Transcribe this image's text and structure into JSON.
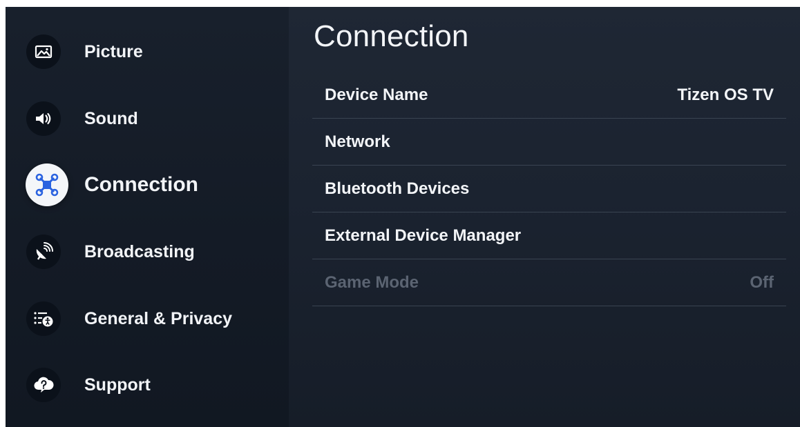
{
  "sidebar": {
    "items": [
      {
        "label": "Picture",
        "icon": "picture-icon"
      },
      {
        "label": "Sound",
        "icon": "speaker-icon"
      },
      {
        "label": "Connection",
        "icon": "connection-icon",
        "active": true
      },
      {
        "label": "Broadcasting",
        "icon": "satellite-dish-icon"
      },
      {
        "label": "General & Privacy",
        "icon": "general-privacy-icon"
      },
      {
        "label": "Support",
        "icon": "help-cloud-icon"
      }
    ]
  },
  "main": {
    "title": "Connection",
    "rows": [
      {
        "label": "Device Name",
        "value": "Tizen OS TV",
        "enabled": true
      },
      {
        "label": "Network",
        "value": "",
        "enabled": true
      },
      {
        "label": "Bluetooth Devices",
        "value": "",
        "enabled": true
      },
      {
        "label": "External Device Manager",
        "value": "",
        "enabled": true
      },
      {
        "label": "Game Mode",
        "value": "Off",
        "enabled": false
      }
    ]
  },
  "colors": {
    "accent": "#2b63e0",
    "sidebar_bg": "#151c27",
    "main_bg": "#1d2532",
    "disabled_text": "#5b6472"
  }
}
